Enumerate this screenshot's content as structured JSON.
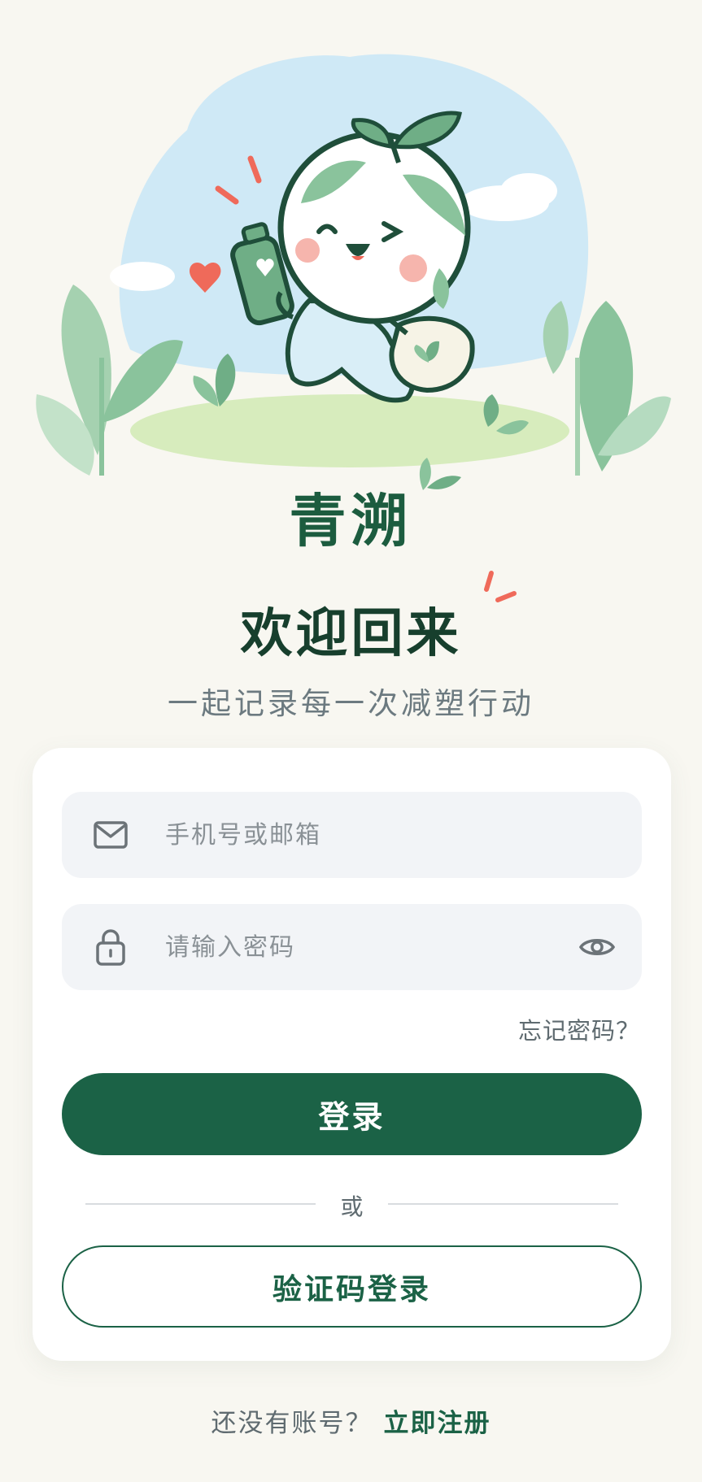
{
  "header": {
    "app_name": "青溯",
    "welcome": "欢迎回来",
    "subtitle": "一起记录每一次减塑行动"
  },
  "form": {
    "account_placeholder": "手机号或邮箱",
    "password_placeholder": "请输入密码",
    "forgot_password": "忘记密码？",
    "login_button": "登录",
    "divider_text": "或",
    "sms_login_button": "验证码登录"
  },
  "footer": {
    "no_account_prompt": "还没有账号？",
    "register_link": "立即注册"
  },
  "icons": {
    "account": "mail-icon",
    "password": "lock-icon",
    "visibility": "eye-icon"
  },
  "colors": {
    "brand_green": "#1b6246",
    "title_green": "#1c5c3f",
    "background": "#f8f7f1"
  }
}
